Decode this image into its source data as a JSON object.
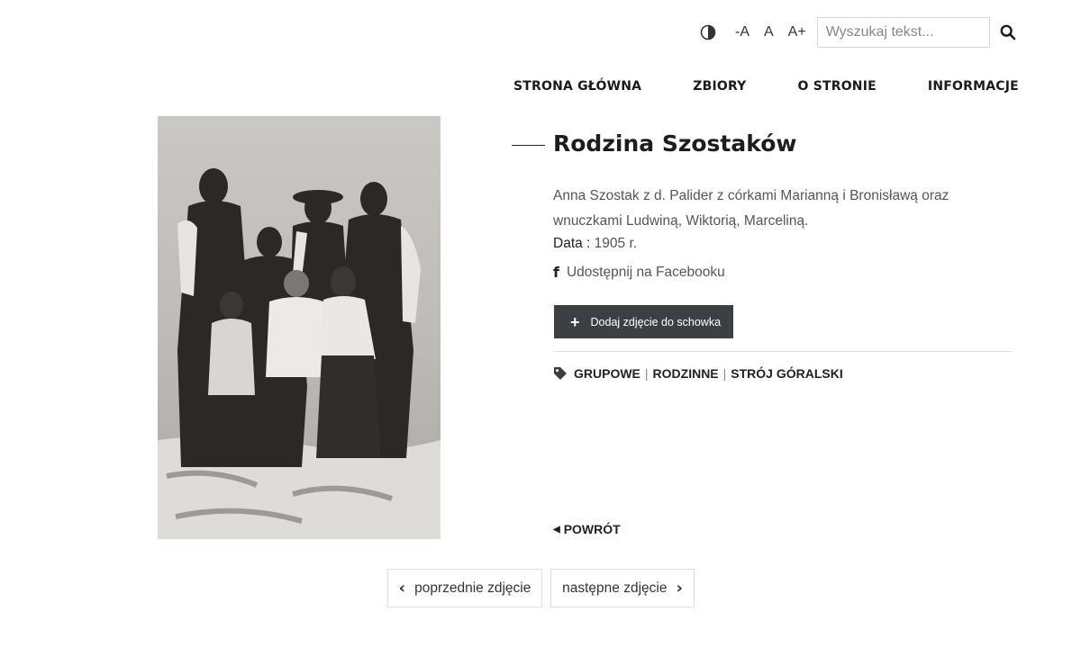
{
  "toolbar": {
    "font_smaller": "-A",
    "font_normal": "A",
    "font_larger": "A+",
    "search_placeholder": "Wyszukaj tekst..."
  },
  "nav": {
    "items": [
      {
        "label": "STRONA GŁÓWNA"
      },
      {
        "label": "ZBIORY"
      },
      {
        "label": "O STRONIE"
      },
      {
        "label": "INFORMACJE"
      }
    ]
  },
  "photo": {
    "kind": "sepia family group photograph"
  },
  "item": {
    "title": "Rodzina Szostaków",
    "description": "Anna Szostak z d. Palider z córkami Marianną i Bronisławą oraz wnuczkami Ludwiną, Wiktorią, Marceliną.",
    "date_label": "Data :",
    "date_value": " 1905 r.",
    "share_label": "Udostępnij na Facebooku",
    "add_button_label": "Dodaj zdjęcie do schowka",
    "tags": [
      "GRUPOWE",
      "RODZINNE",
      "STRÓJ GÓRALSKI"
    ],
    "back_label": "POWRÓT"
  },
  "pager": {
    "prev_label": "poprzednie zdjęcie",
    "next_label": "następne zdjęcie"
  },
  "colors": {
    "button_bg": "#3c4043",
    "text_dark": "#1d1d1d",
    "text_muted": "#555555"
  }
}
